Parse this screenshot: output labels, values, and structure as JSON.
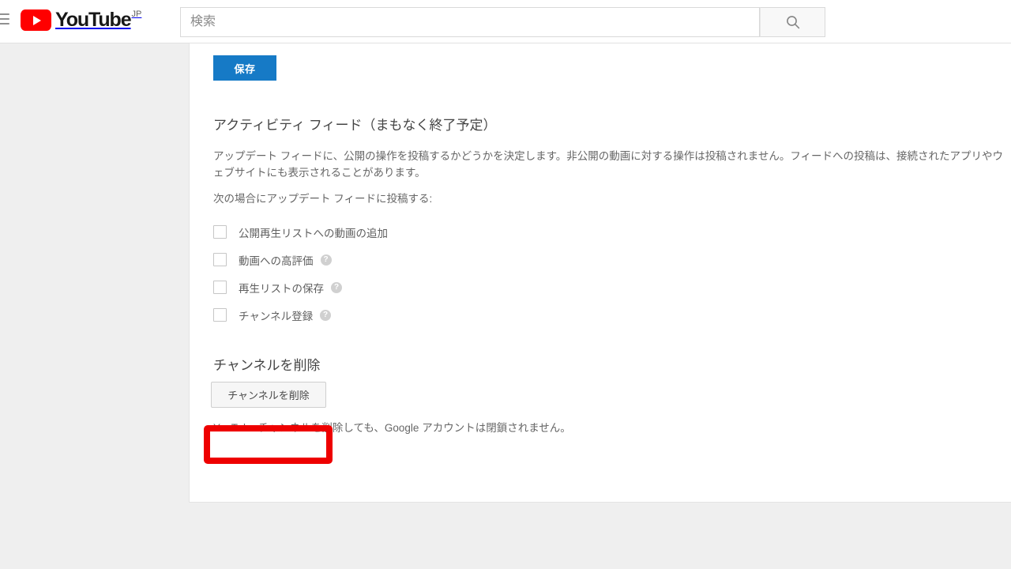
{
  "header": {
    "menu_icon": "hamburger-menu-icon",
    "logo_text": "YouTube",
    "logo_superscript": "JP",
    "logo_color": "#ff0000",
    "search_placeholder": "検索",
    "search_value": "",
    "search_icon": "search-icon"
  },
  "content": {
    "save_label": "保存",
    "save_color": "#167ac6",
    "feed_heading": "アクティビティ フィード（まもなく終了予定）",
    "feed_description": "アップデート フィードに、公開の操作を投稿するかどうかを決定します。非公開の動画に対する操作は投稿されません。フィードへの投稿は、接続されたアプリやウェブサイトにも表示されることがあります。",
    "feed_subtitle": "次の場合にアップデート フィードに投稿する:",
    "checkboxes": [
      {
        "label": "公開再生リストへの動画の追加",
        "checked": false,
        "has_help": false,
        "help_glyph": "?"
      },
      {
        "label": "動画への高評価",
        "checked": false,
        "has_help": true,
        "help_glyph": "?"
      },
      {
        "label": "再生リストの保存",
        "checked": false,
        "has_help": true,
        "help_glyph": "?"
      },
      {
        "label": "チャンネル登録",
        "checked": false,
        "has_help": true,
        "help_glyph": "?"
      }
    ],
    "delete_heading": "チャンネルを削除",
    "delete_button_label": "チャンネルを削除",
    "delete_note": "YouTube チャンネルを削除しても、Google アカウントは閉鎖されません。"
  },
  "annotation": {
    "type": "highlight-rectangle",
    "target": "delete-channel-button",
    "color": "#ee0000"
  }
}
